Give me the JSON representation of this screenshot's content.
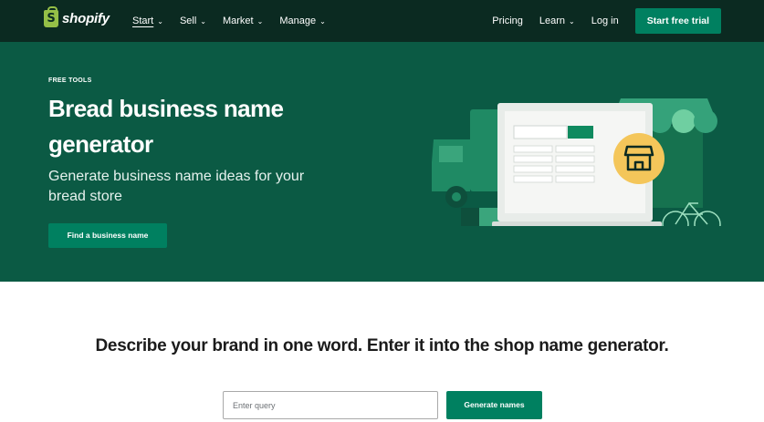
{
  "nav": {
    "logo_text": "shopify",
    "logo_mark": "S",
    "menu": [
      {
        "label": "Start",
        "active": true
      },
      {
        "label": "Sell",
        "active": false
      },
      {
        "label": "Market",
        "active": false
      },
      {
        "label": "Manage",
        "active": false
      }
    ],
    "right": {
      "pricing": "Pricing",
      "learn": "Learn",
      "login": "Log in",
      "trial": "Start free trial"
    },
    "chevron_icon": "chevron-down-icon"
  },
  "hero": {
    "eyebrow": "FREE TOOLS",
    "title": "Bread business name generator",
    "subtitle": "Generate business name ideas for your bread store",
    "cta": "Find a business name",
    "illustration_icons": [
      "truck-icon",
      "laptop-icon",
      "storefront-icon",
      "bicycle-icon"
    ]
  },
  "generator": {
    "headline": "Describe your brand in one word. Enter it into the shop name generator.",
    "input_placeholder": "Enter query",
    "input_value": "",
    "button": "Generate names"
  },
  "colors": {
    "nav_bg": "#0b2a21",
    "hero_bg": "#0b5a44",
    "accent": "#008060",
    "logo_green": "#95bf47"
  }
}
